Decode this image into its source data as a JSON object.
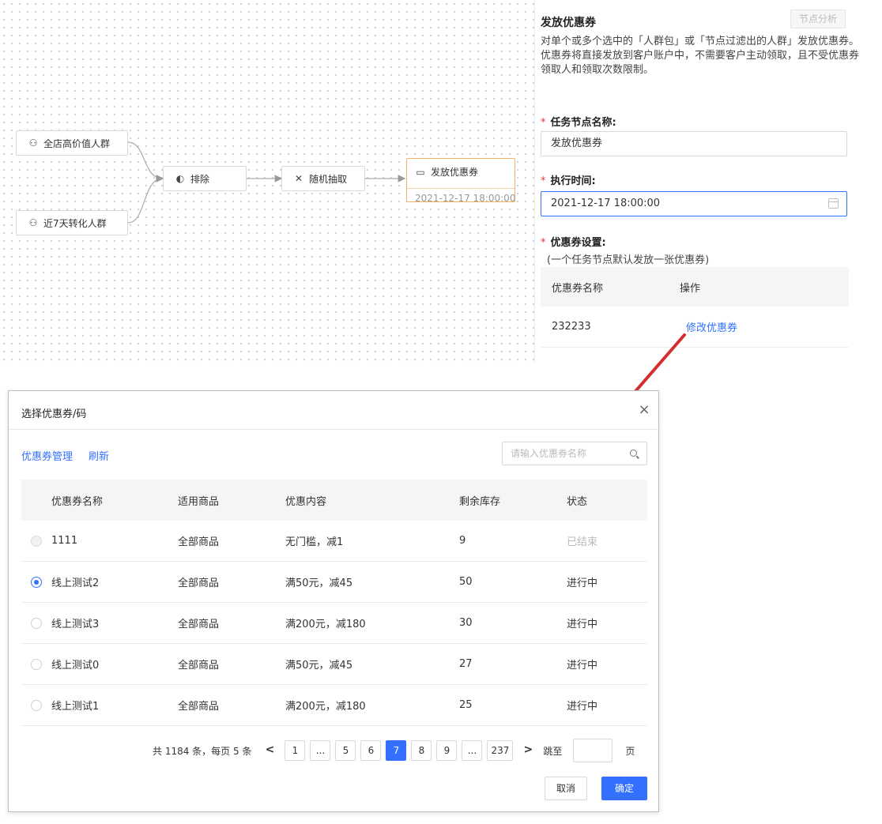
{
  "flow": {
    "nodes": {
      "high_value": {
        "label": "全店高价值人群",
        "icon": "people-group-icon"
      },
      "recent_convert": {
        "label": "近7天转化人群",
        "icon": "people-group-icon"
      },
      "exclude": {
        "label": "排除",
        "icon": "exclude-toggle-icon"
      },
      "random": {
        "label": "随机抽取",
        "icon": "shuffle-icon"
      },
      "coupon": {
        "label": "发放优惠券",
        "time": "2021-12-17 18:00:00",
        "icon": "coupon-icon"
      }
    }
  },
  "panel": {
    "title": "发放优惠券",
    "analysis_button": "节点分析",
    "description": "对单个或多个选中的「人群包」或「节点过滤出的人群」发放优惠券。优惠券将直接发放到客户账户中，不需要客户主动领取，且不受优惠券领取人和领取次数限制。",
    "node_name_label": "任务节点名称:",
    "node_name_value": "发放优惠券",
    "exec_time_label": "执行时间:",
    "exec_time_value": "2021-12-17 18:00:00",
    "coupon_setting_label": "优惠券设置:",
    "coupon_note": "(一个任务节点默认发放一张优惠券)",
    "table_headers": [
      "优惠券名称",
      "操作"
    ],
    "table_row": {
      "name": "232233",
      "action": "修改优惠券"
    }
  },
  "modal": {
    "title": "选择优惠券/码",
    "close": "×",
    "links": {
      "manage": "优惠券管理",
      "refresh": "刷新"
    },
    "search_placeholder": "请输入优惠券名称",
    "headers": [
      "优惠券名称",
      "适用商品",
      "优惠内容",
      "剩余库存",
      "状态"
    ],
    "rows": [
      {
        "name": "1111",
        "goods": "全部商品",
        "content": "无门槛，减1",
        "stock": "9",
        "status": "已结束",
        "selected": false,
        "disabled": true
      },
      {
        "name": "线上测试2",
        "goods": "全部商品",
        "content": "满50元，减45",
        "stock": "50",
        "status": "进行中",
        "selected": true,
        "disabled": false
      },
      {
        "name": "线上测试3",
        "goods": "全部商品",
        "content": "满200元，减180",
        "stock": "30",
        "status": "进行中",
        "selected": false,
        "disabled": false
      },
      {
        "name": "线上测试0",
        "goods": "全部商品",
        "content": "满50元，减45",
        "stock": "27",
        "status": "进行中",
        "selected": false,
        "disabled": false
      },
      {
        "name": "线上测试1",
        "goods": "全部商品",
        "content": "满200元，减180",
        "stock": "25",
        "status": "进行中",
        "selected": false,
        "disabled": false
      }
    ],
    "pagination": {
      "total_text": "共 1184 条，每页 5 条",
      "prev": "<",
      "next": ">",
      "pages": [
        "1",
        "...",
        "5",
        "6",
        "7",
        "8",
        "9",
        "...",
        "237"
      ],
      "current": "7",
      "jump_label": "跳至",
      "page_unit": "页"
    },
    "cancel": "取消",
    "ok": "确定"
  },
  "colors": {
    "accent": "#3370ff",
    "required": "#e4393c",
    "coupon_node_border": "#f0b36b",
    "arrow": "#d32f2f"
  }
}
